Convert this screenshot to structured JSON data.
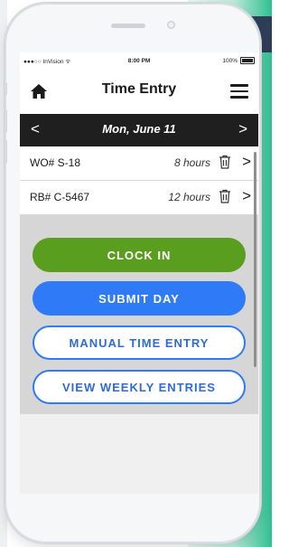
{
  "status": {
    "carrier": "●●●○○ InVision ᯤ",
    "time": "8:00 PM",
    "battery": "100%"
  },
  "header": {
    "title": "Time Entry",
    "home_icon": "home-icon",
    "menu_icon": "hamburger-menu-icon"
  },
  "datebar": {
    "prev": "<",
    "date": "Mon, June 11",
    "next": ">"
  },
  "entries": [
    {
      "label": "WO# S-18",
      "hours": "8 hours"
    },
    {
      "label": "RB# C-5467",
      "hours": "12 hours"
    }
  ],
  "actions": {
    "clock_in": "CLOCK IN",
    "submit_day": "SUBMIT DAY",
    "manual_entry": "MANUAL TIME ENTRY",
    "weekly_entries": "VIEW WEEKLY ENTRIES"
  },
  "colors": {
    "clock_in": "#5a9e1f",
    "submit_day": "#2f7af6",
    "outline": "#2f7af6",
    "datebar": "#1f1f1f"
  }
}
